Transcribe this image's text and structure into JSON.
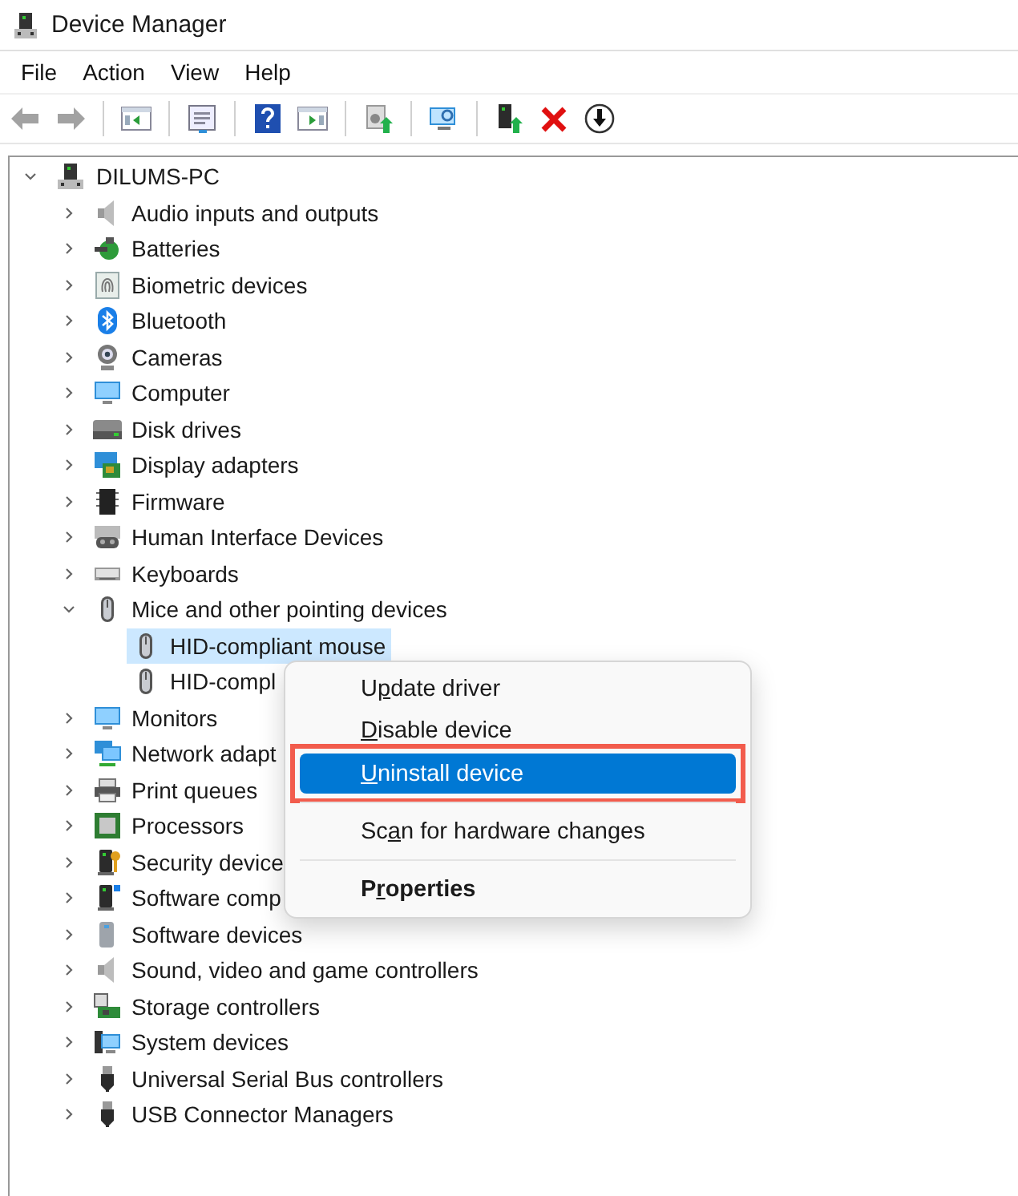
{
  "window": {
    "title": "Device Manager"
  },
  "menu_bar": [
    "File",
    "Action",
    "View",
    "Help"
  ],
  "toolbar": [
    {
      "disabled": true
    },
    {
      "disabled": true
    },
    {
      "disabled": false
    },
    {
      "disabled": false
    },
    {
      "disabled": false
    },
    {
      "disabled": false
    },
    {
      "disabled": false
    },
    {
      "disabled": false
    },
    {
      "disabled": false
    },
    {
      "disabled": false
    },
    {
      "disabled": false
    }
  ],
  "tree": {
    "label": "DILUMS-PC",
    "expanded": true,
    "selected": false,
    "children": [
      {
        "label": "Audio inputs and outputs",
        "expanded": false,
        "selected": false
      },
      {
        "label": "Batteries",
        "expanded": false,
        "selected": false
      },
      {
        "label": "Biometric devices",
        "expanded": false,
        "selected": false
      },
      {
        "label": "Bluetooth",
        "expanded": false,
        "selected": false
      },
      {
        "label": "Cameras",
        "expanded": false,
        "selected": false
      },
      {
        "label": "Computer",
        "expanded": false,
        "selected": false
      },
      {
        "label": "Disk drives",
        "expanded": false,
        "selected": false
      },
      {
        "label": "Display adapters",
        "expanded": false,
        "selected": false
      },
      {
        "label": "Firmware",
        "expanded": false,
        "selected": false
      },
      {
        "label": "Human Interface Devices",
        "expanded": false,
        "selected": false
      },
      {
        "label": "Keyboards",
        "expanded": false,
        "selected": false
      },
      {
        "label": "Mice and other pointing devices",
        "expanded": true,
        "selected": false,
        "children": [
          {
            "label": "HID-compliant mouse",
            "selected": true
          },
          {
            "label": "HID-compl",
            "selected": false
          }
        ]
      },
      {
        "label": "Monitors",
        "expanded": false,
        "selected": false
      },
      {
        "label": "Network adapt",
        "expanded": false,
        "selected": false
      },
      {
        "label": "Print queues",
        "expanded": false,
        "selected": false
      },
      {
        "label": "Processors",
        "expanded": false,
        "selected": false
      },
      {
        "label": "Security device",
        "expanded": false,
        "selected": false
      },
      {
        "label": "Software comp",
        "expanded": false,
        "selected": false
      },
      {
        "label": "Software devices",
        "expanded": false,
        "selected": false
      },
      {
        "label": "Sound, video and game controllers",
        "expanded": false,
        "selected": false
      },
      {
        "label": "Storage controllers",
        "expanded": false,
        "selected": false
      },
      {
        "label": "System devices",
        "expanded": false,
        "selected": false
      },
      {
        "label": "Universal Serial Bus controllers",
        "expanded": false,
        "selected": false
      },
      {
        "label": "USB Connector Managers",
        "expanded": false,
        "selected": false
      }
    ]
  },
  "context_menu": {
    "items": [
      {
        "kind": "item",
        "pre": "U",
        "key": "p",
        "post": "date driver",
        "selected": false,
        "outlined": false
      },
      {
        "kind": "item",
        "key": "D",
        "post": "isable device",
        "selected": false,
        "outlined": false
      },
      {
        "kind": "item",
        "key": "U",
        "post": "ninstall device",
        "selected": true,
        "outlined": true
      },
      {
        "kind": "separator"
      },
      {
        "kind": "item",
        "pre": "Sc",
        "key": "a",
        "post": "n for hardware changes",
        "selected": false,
        "outlined": false
      },
      {
        "kind": "separator"
      },
      {
        "kind": "default",
        "pre": "P",
        "key": "r",
        "post": "operties",
        "selected": false,
        "outlined": false
      }
    ]
  }
}
